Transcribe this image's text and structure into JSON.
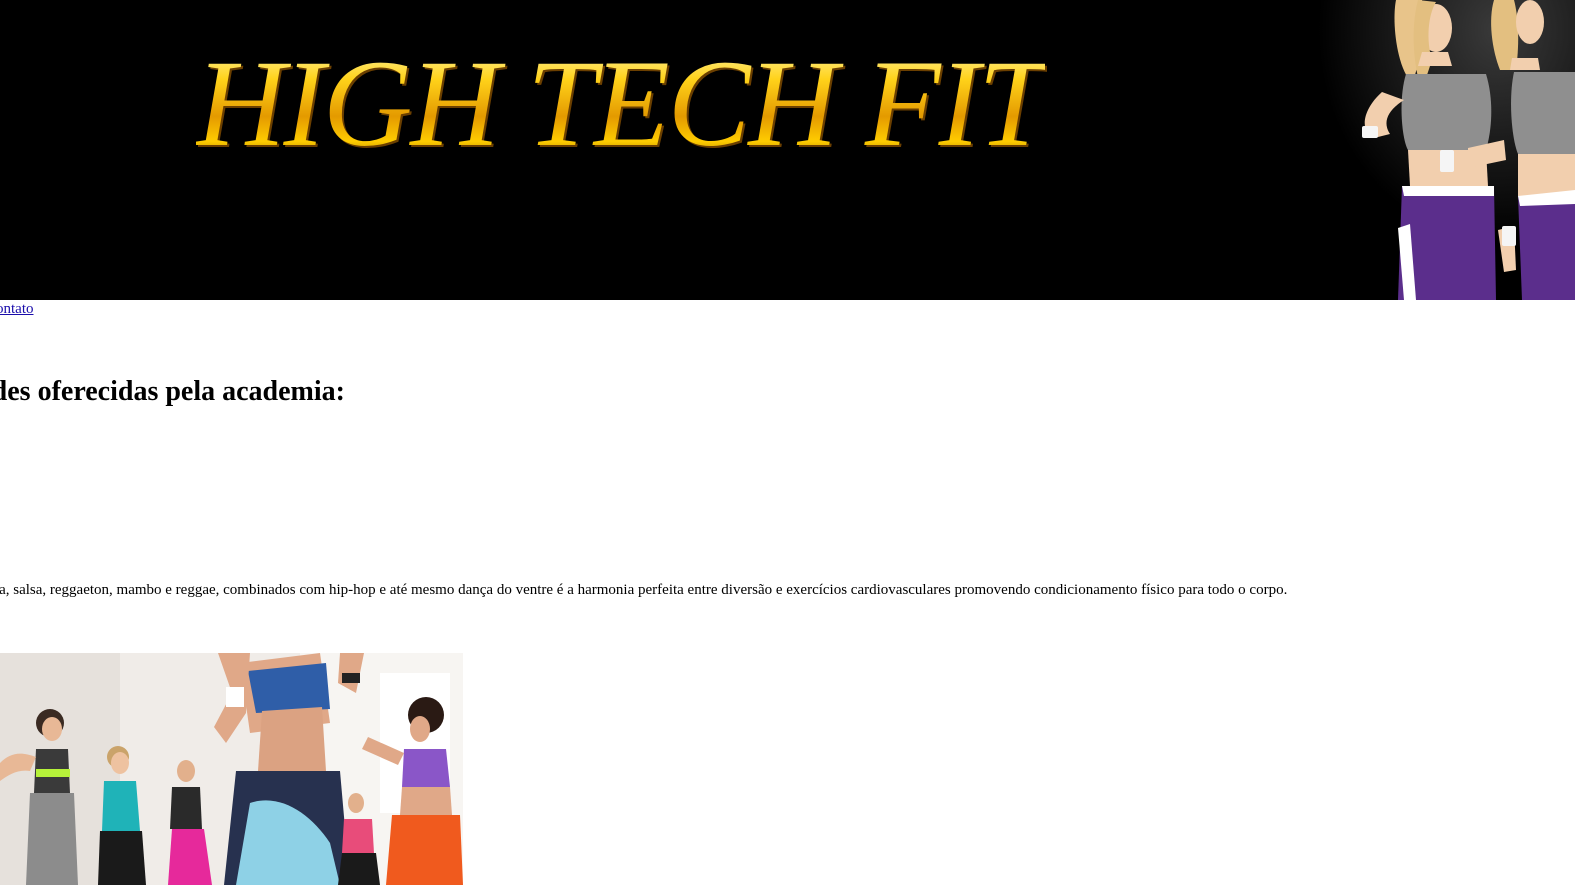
{
  "banner": {
    "title": "HIGH TECH FIT",
    "image": "fitness-models-photo"
  },
  "nav": {
    "link_label": "Contato"
  },
  "section": {
    "heading": "Atividades oferecidas pela academia:",
    "description": "Ritmos latinos com samba, salsa, reggaeton, mambo e reggae, combinados com hip-hop e até mesmo dança do ventre é a harmonia perfeita entre diversão e exercícios cardiovasculares promovendo condicionamento físico para todo o corpo.",
    "image": "dance-class-photo"
  },
  "colors": {
    "banner_background": "#000000",
    "title_gold": "#f2c200",
    "link": "#1a0dab",
    "text": "#000000",
    "page_background": "#ffffff"
  }
}
